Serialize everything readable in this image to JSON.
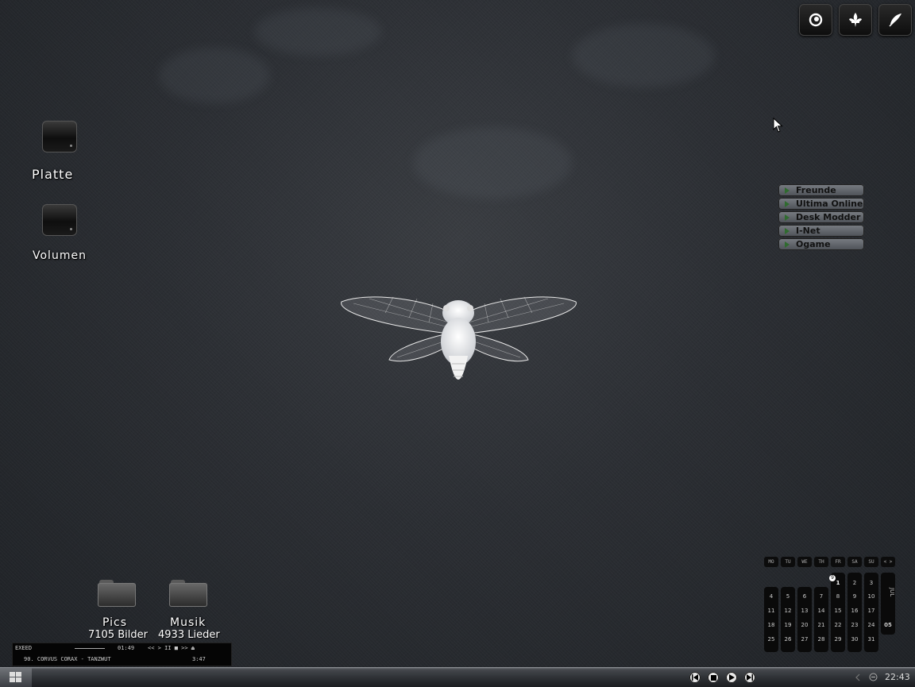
{
  "desktop": {
    "icons": {
      "platte": "Platte",
      "volumen": "Volumen",
      "pics": "Pics",
      "pics_count": "7105 Bilder",
      "musik": "Musik",
      "musik_count": "4933 Lieder"
    }
  },
  "quicklaunch": {
    "items": [
      "swirl-icon",
      "fleur-de-lis-icon",
      "feather-icon"
    ]
  },
  "link_menu": {
    "items": [
      "Freunde",
      "Ultima Online",
      "Desk Modder",
      "I-Net",
      "Ogame"
    ]
  },
  "calendar": {
    "day_headers": [
      "MO",
      "TU",
      "WE",
      "TH",
      "FR",
      "SA",
      "SU"
    ],
    "nav": "< >",
    "month": "JUL",
    "year": "05",
    "today": "1",
    "today_badge": "9",
    "weeks": [
      [
        "",
        "",
        "",
        "",
        "1",
        "2",
        "3"
      ],
      [
        "4",
        "5",
        "6",
        "7",
        "8",
        "9",
        "10"
      ],
      [
        "11",
        "12",
        "13",
        "14",
        "15",
        "16",
        "17"
      ],
      [
        "18",
        "19",
        "20",
        "21",
        "22",
        "23",
        "24"
      ],
      [
        "25",
        "26",
        "27",
        "28",
        "29",
        "30",
        "31"
      ]
    ]
  },
  "player": {
    "name": "EXEED",
    "time": "01:49",
    "controls": "<< > II ■ >> ⏏",
    "track": "90. CORVUS CORAX - TANZWUT",
    "duration": "3:47"
  },
  "taskbar": {
    "clock": "22:43",
    "controls": [
      "previous-icon",
      "stop-icon",
      "play-icon",
      "next-icon"
    ]
  }
}
